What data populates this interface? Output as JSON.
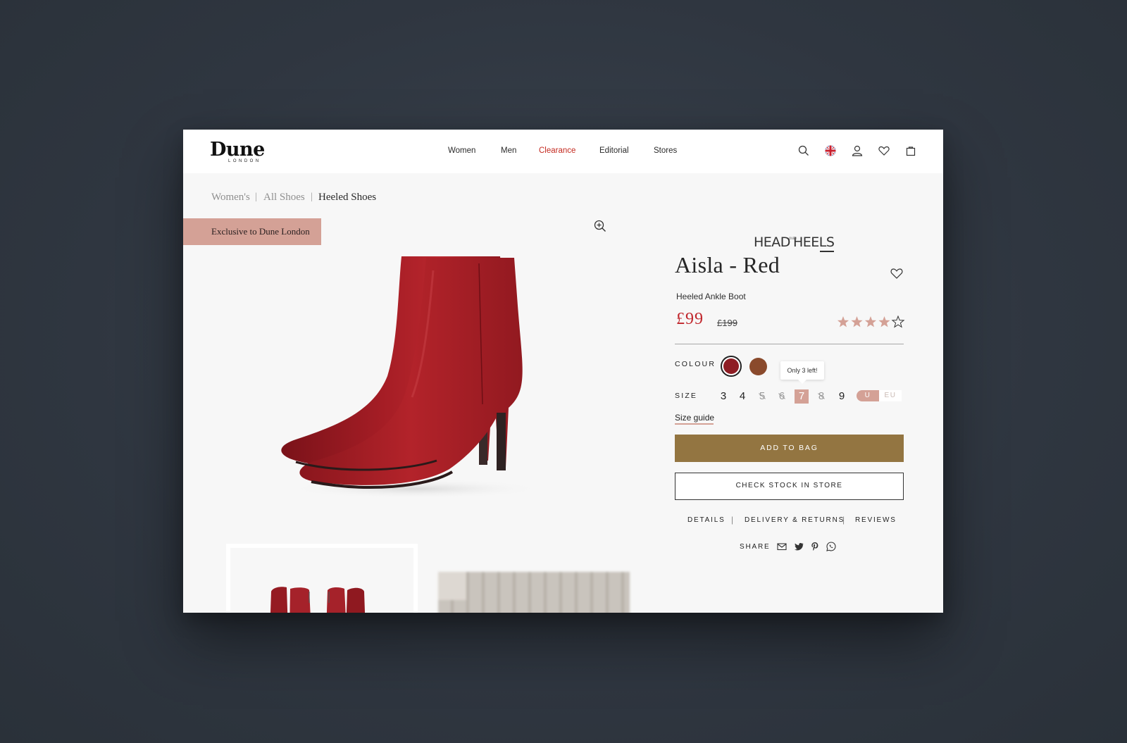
{
  "header": {
    "logo": "Dune",
    "logo_sub": "LONDON",
    "nav": [
      {
        "label": "Women"
      },
      {
        "label": "Men"
      },
      {
        "label": "Clearance"
      },
      {
        "label": "Editorial"
      },
      {
        "label": "Stores"
      }
    ]
  },
  "breadcrumb": [
    {
      "label": "Women's"
    },
    {
      "label": "All Shoes"
    },
    {
      "label": "Heeled Shoes"
    }
  ],
  "breadcrumb_separator": "|",
  "gallery": {
    "badge": "Exclusive to Dune London"
  },
  "product": {
    "brand_logo": "HEAD OVER HEELS",
    "title": "Aisla - Red",
    "subtitle": "Heeled Ankle Boot",
    "price": "£99",
    "was_price": "£199",
    "rating": 4,
    "rating_max": 5,
    "colour_label": "COLOUR",
    "colours": [
      {
        "hex": "#8e1d24",
        "selected": true
      },
      {
        "hex": "#8a4a2c",
        "selected": false
      }
    ],
    "size_label": "SIZE",
    "sizes": [
      {
        "label": "3",
        "state": "available"
      },
      {
        "label": "4",
        "state": "available"
      },
      {
        "label": "5",
        "state": "out-of-stock"
      },
      {
        "label": "6",
        "state": "out-of-stock"
      },
      {
        "label": "7",
        "state": "selected"
      },
      {
        "label": "8",
        "state": "out-of-stock"
      },
      {
        "label": "9",
        "state": "available"
      }
    ],
    "stock_tooltip": "Only 3 left!",
    "units": [
      {
        "label": "U",
        "active": true
      },
      {
        "label": "EU",
        "active": false
      }
    ],
    "size_guide": "Size guide",
    "add_to_bag": "ADD TO BAG",
    "check_stock": "CHECK STOCK IN STORE",
    "tabs": [
      {
        "label": "DETAILS"
      },
      {
        "label": "DELIVERY & RETURNS"
      },
      {
        "label": "REVIEWS"
      }
    ],
    "tab_separator": "|",
    "share_label": "SHARE"
  },
  "colors": {
    "accent": "#d4a196",
    "add_button": "#937541",
    "price": "#c0252b",
    "clearance": "#c42a20"
  }
}
